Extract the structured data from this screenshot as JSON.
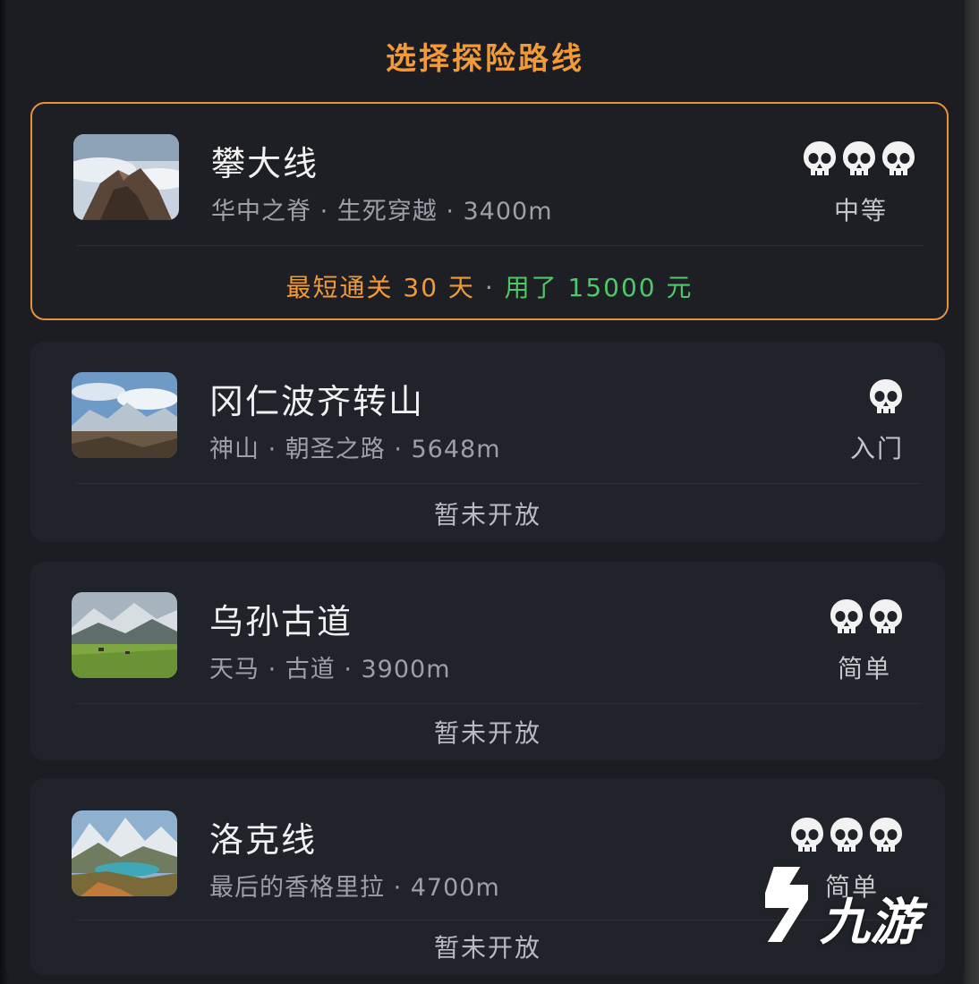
{
  "header": {
    "title": "选择探险路线"
  },
  "routes": [
    {
      "name": "攀大线",
      "subtitle": "华中之脊 · 生死穿越 · 3400m",
      "difficulty_label": "中等",
      "difficulty_skulls": 3,
      "selected": true,
      "footer": {
        "best_label": "最短通关 30 天",
        "separator": "·",
        "cost_label": "用了 15000 元"
      }
    },
    {
      "name": "冈仁波齐转山",
      "subtitle": "神山 · 朝圣之路 · 5648m",
      "difficulty_label": "入门",
      "difficulty_skulls": 1,
      "selected": false,
      "footer": {
        "status": "暂未开放"
      }
    },
    {
      "name": "乌孙古道",
      "subtitle": "天马 · 古道 · 3900m",
      "difficulty_label": "简单",
      "difficulty_skulls": 2,
      "selected": false,
      "footer": {
        "status": "暂未开放"
      }
    },
    {
      "name": "洛克线",
      "subtitle": "最后的香格里拉 · 4700m",
      "difficulty_label": "简单",
      "difficulty_skulls": 3,
      "selected": false,
      "footer": {
        "status": "暂未开放"
      }
    }
  ],
  "watermark": {
    "text": "九游"
  },
  "colors": {
    "accent": "#f29a37",
    "cost_green": "#4fc867",
    "card_bg": "#20232a",
    "panel_bg": "#1b1d23"
  }
}
